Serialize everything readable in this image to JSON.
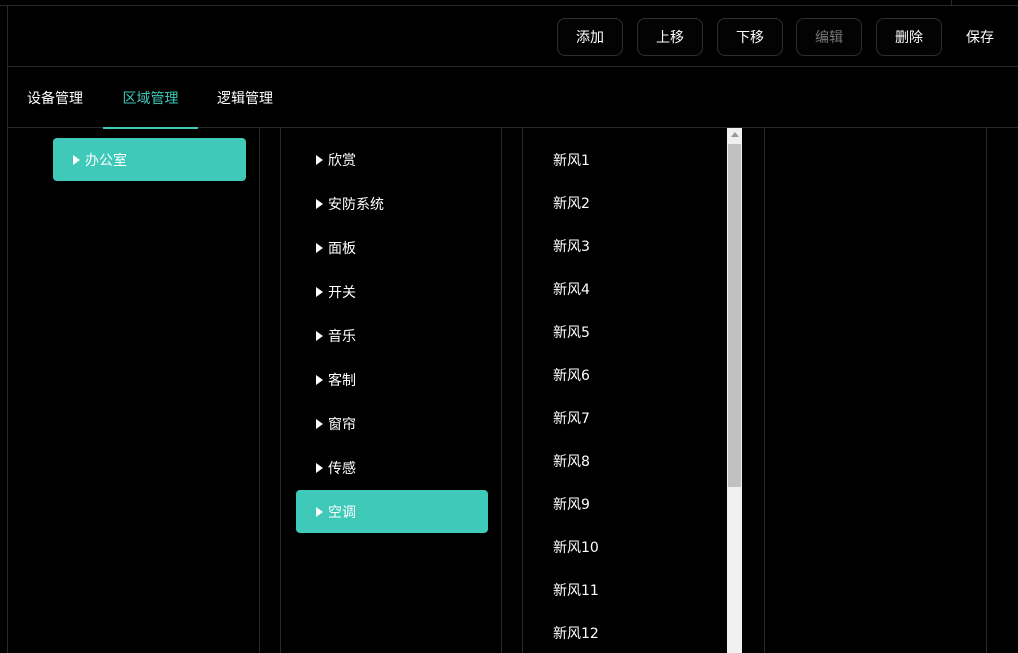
{
  "toolbar": {
    "add_label": "添加",
    "move_up_label": "上移",
    "move_down_label": "下移",
    "edit_label": "编辑",
    "delete_label": "删除",
    "save_label": "保存"
  },
  "tabs": [
    {
      "label": "设备管理",
      "active": false
    },
    {
      "label": "区域管理",
      "active": true
    },
    {
      "label": "逻辑管理",
      "active": false
    }
  ],
  "areas": [
    {
      "label": "办公室",
      "selected": true
    }
  ],
  "categories": [
    {
      "label": "欣赏",
      "selected": false
    },
    {
      "label": "安防系统",
      "selected": false
    },
    {
      "label": "面板",
      "selected": false
    },
    {
      "label": "开关",
      "selected": false
    },
    {
      "label": "音乐",
      "selected": false
    },
    {
      "label": "客制",
      "selected": false
    },
    {
      "label": "窗帘",
      "selected": false
    },
    {
      "label": "传感",
      "selected": false
    },
    {
      "label": "空调",
      "selected": true
    }
  ],
  "devices": [
    "新风1",
    "新风2",
    "新风3",
    "新风4",
    "新风5",
    "新风6",
    "新风7",
    "新风8",
    "新风9",
    "新风10",
    "新风11",
    "新风12"
  ],
  "colors": {
    "accent": "#3ec9b8",
    "background": "#000000",
    "border": "#2a2a2a"
  }
}
